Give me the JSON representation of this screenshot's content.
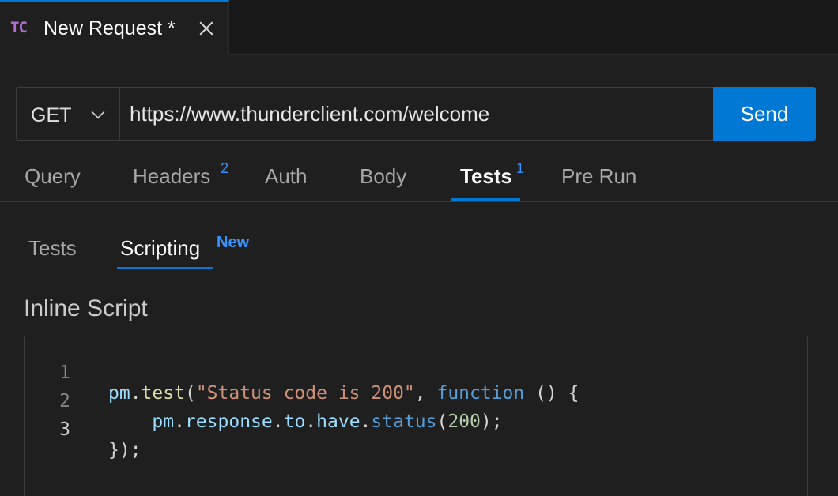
{
  "tab": {
    "icon_text": "TC",
    "title": "New Request *",
    "close_icon": "close-icon"
  },
  "request": {
    "method": "GET",
    "url": "https://www.thunderclient.com/welcome",
    "send_label": "Send"
  },
  "main_tabs": [
    {
      "label": "Query",
      "badge": ""
    },
    {
      "label": "Headers",
      "badge": "2"
    },
    {
      "label": "Auth",
      "badge": ""
    },
    {
      "label": "Body",
      "badge": ""
    },
    {
      "label": "Tests",
      "badge": "1",
      "active": true
    },
    {
      "label": "Pre Run",
      "badge": ""
    }
  ],
  "sub_tabs": [
    {
      "label": "Tests"
    },
    {
      "label": "Scripting",
      "badge": "New",
      "active": true
    }
  ],
  "section_label": "Inline Script",
  "editor": {
    "line_numbers": [
      "1",
      "2",
      "3"
    ],
    "lines": [
      "pm.test(\"Status code is 200\", function () {",
      "    pm.response.to.have.status(200);",
      "});"
    ],
    "tokens": {
      "l1_pm": "pm",
      "l1_dot": ".",
      "l1_test": "test",
      "l1_open": "(",
      "l1_str": "\"Status code is 200\"",
      "l1_comma": ", ",
      "l1_kw": "function",
      "l1_rest": " () {",
      "l2_indent": "    ",
      "l2_pm": "pm",
      "l2_d1": ".",
      "l2_response": "response",
      "l2_d2": ".",
      "l2_to": "to",
      "l2_d3": ".",
      "l2_have": "have",
      "l2_d4": ".",
      "l2_status": "status",
      "l2_open": "(",
      "l2_num": "200",
      "l2_close": ");",
      "l3": "});"
    }
  },
  "colors": {
    "accent": "#0078d4",
    "badge": "#3794ff",
    "logo": "#b36bd6"
  }
}
